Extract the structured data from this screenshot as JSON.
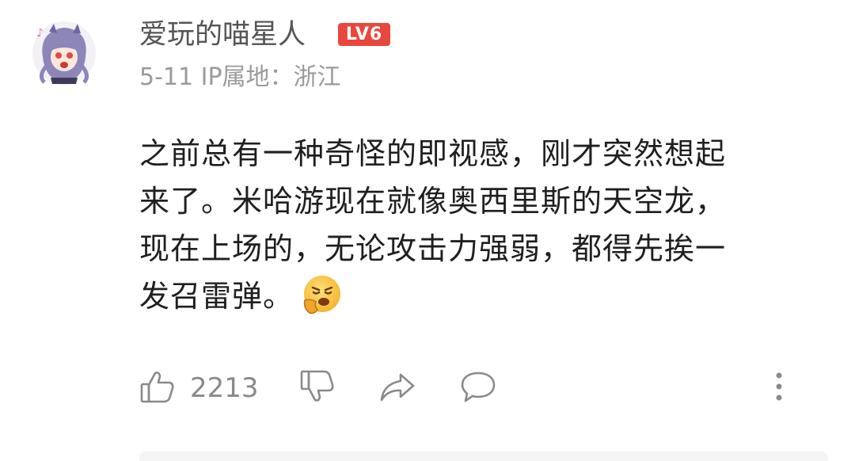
{
  "user": {
    "name": "爱玩的喵星人",
    "level": "LV6",
    "level_color": "#e8473d"
  },
  "meta": {
    "text": "5-11 IP属地：浙江"
  },
  "comment": {
    "lines": [
      "之前总有一种奇怪的即视感，刚才突然想起",
      "来了。米哈游现在就像奥西里斯的天空龙，",
      "现在上场的，无论攻击力强弱，都得先挨一",
      "发召雷弹。"
    ],
    "emoji": "shock-face-emoji"
  },
  "actions": {
    "like_count": "2213",
    "icons": [
      "thumbs-up-icon",
      "thumbs-down-icon",
      "share-icon",
      "comment-icon",
      "more-icon"
    ]
  }
}
